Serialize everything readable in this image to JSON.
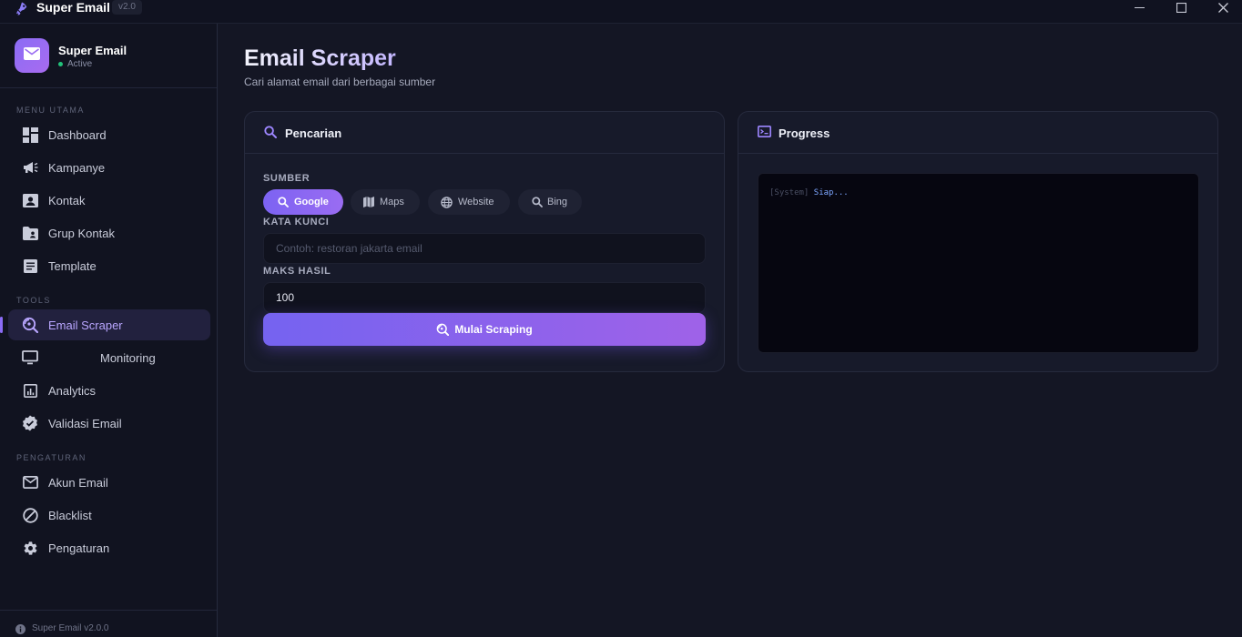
{
  "titlebar": {
    "title": "Super Email",
    "version": "v2.0",
    "controls": [
      "minimize-icon",
      "maximize-icon",
      "close-icon"
    ]
  },
  "sidebar": {
    "brand": {
      "name": "Super Email",
      "status": "Active"
    },
    "sections": [
      {
        "label": "MENU UTAMA",
        "items": [
          {
            "label": "Dashboard",
            "icon": "dashboard-icon"
          },
          {
            "label": "Kampanye",
            "icon": "megaphone-icon"
          },
          {
            "label": "Kontak",
            "icon": "contact-card-icon"
          },
          {
            "label": "Grup Kontak",
            "icon": "folder-user-icon"
          },
          {
            "label": "Template",
            "icon": "document-icon"
          }
        ]
      },
      {
        "label": "TOOLS",
        "items": [
          {
            "label": "Email Scraper",
            "icon": "scraper-icon",
            "active": true
          },
          {
            "label": "Monitoring",
            "icon": "monitor-icon"
          },
          {
            "label": "Analytics",
            "icon": "analytics-icon"
          },
          {
            "label": "Validasi Email",
            "icon": "verified-badge-icon"
          }
        ]
      },
      {
        "label": "PENGATURAN",
        "items": [
          {
            "label": "Akun Email",
            "icon": "mail-icon"
          },
          {
            "label": "Blacklist",
            "icon": "block-icon"
          },
          {
            "label": "Pengaturan",
            "icon": "gear-icon"
          }
        ]
      }
    ],
    "footer": "Super Email v2.0.0"
  },
  "main": {
    "title": "Email Scraper",
    "subtitle": "Cari alamat email dari berbagai sumber",
    "search_card": {
      "title": "Pencarian",
      "source_label": "SUMBER",
      "sources": [
        {
          "label": "Google",
          "icon": "search-icon",
          "active": true
        },
        {
          "label": "Maps",
          "icon": "map-icon"
        },
        {
          "label": "Website",
          "icon": "globe-icon"
        },
        {
          "label": "Bing",
          "icon": "search-icon"
        }
      ],
      "keyword_label": "KATA KUNCI",
      "keyword_value": "",
      "keyword_placeholder": "Contoh: restoran jakarta email",
      "max_label": "MAKS HASIL",
      "max_value": "100",
      "button_label": "Mulai Scraping"
    },
    "progress_card": {
      "title": "Progress",
      "console": [
        {
          "tag": "[System]",
          "message": "Siap..."
        }
      ]
    }
  },
  "colors": {
    "accent": "#8b6cf5",
    "background": "#141624",
    "sidebar": "#111320",
    "card": "#171a2a",
    "status_green": "#22c27a"
  }
}
